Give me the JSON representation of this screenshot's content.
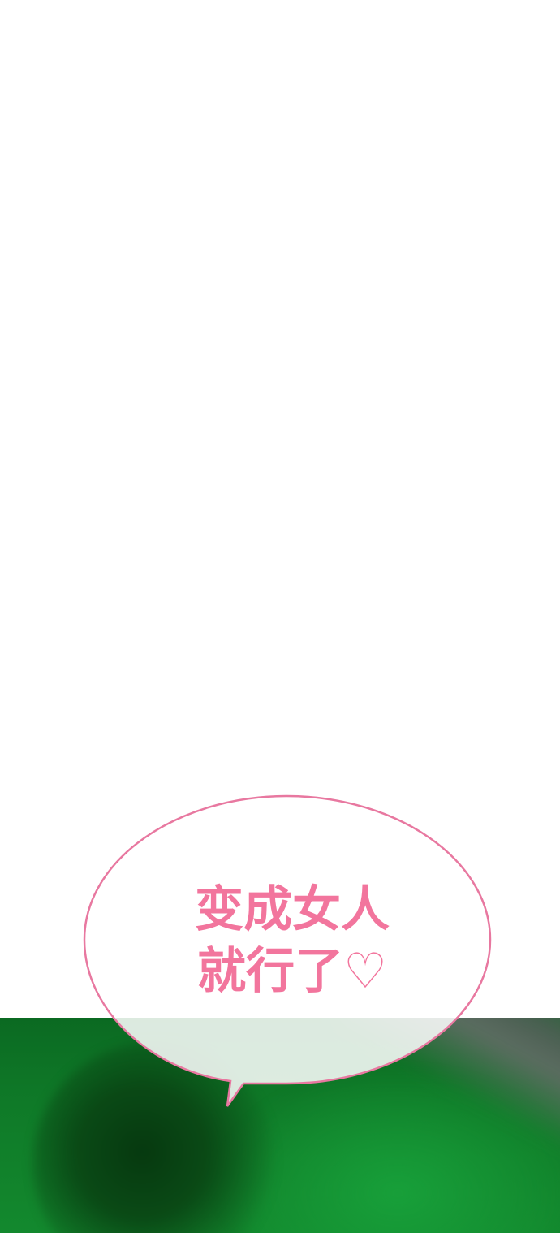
{
  "speech_bubble": {
    "line1": "变成女人",
    "line2": "就行了♡"
  },
  "colors": {
    "bubble_text": "#f2759d",
    "bubble_outline": "#e878a0",
    "scene_green": "#0f7a28",
    "background": "#ffffff"
  }
}
